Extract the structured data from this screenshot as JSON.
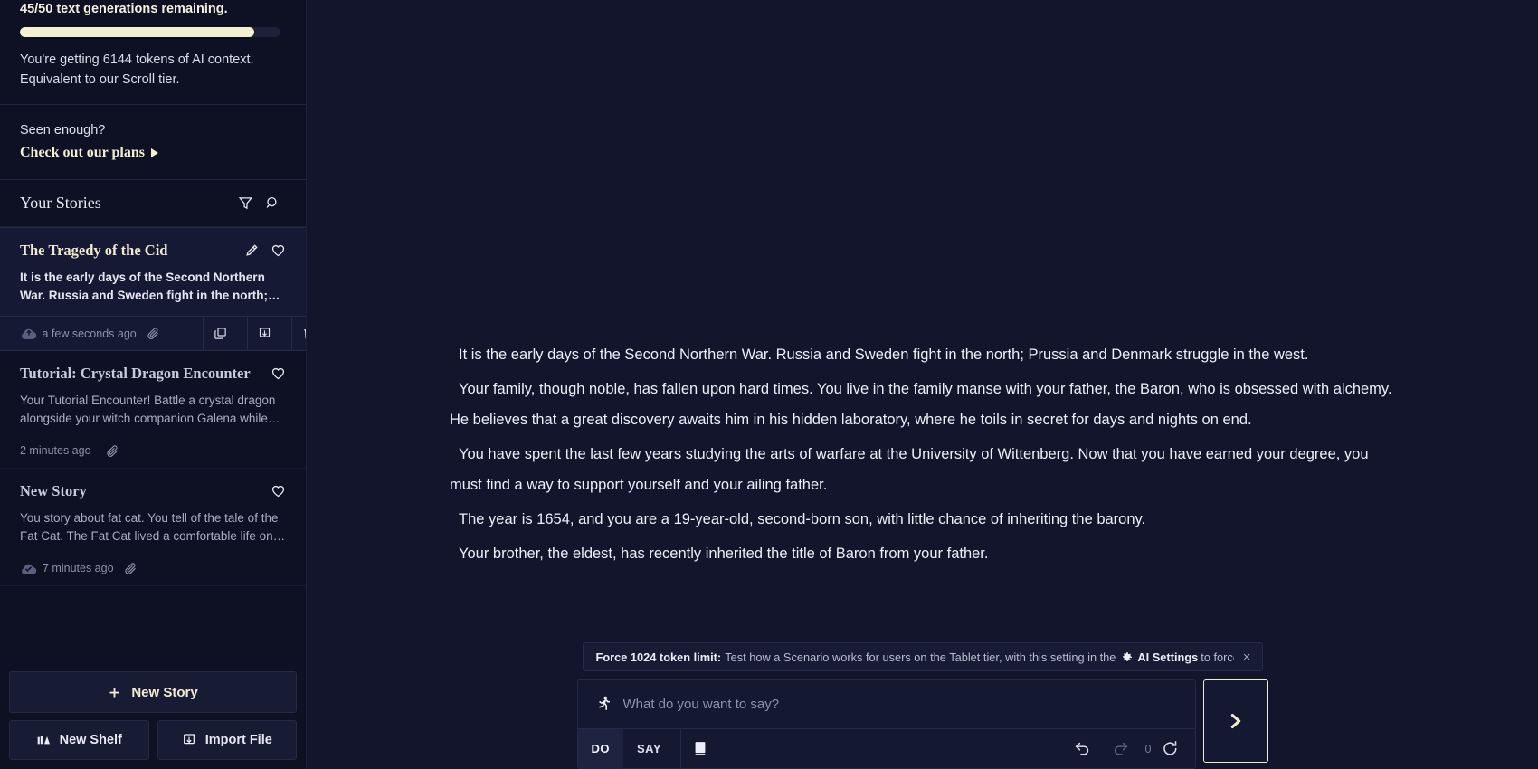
{
  "sidebar": {
    "usage": {
      "headline": "45/50 text generations remaining.",
      "progress_percent": 90,
      "context_line1": "You're getting 6144 tokens of AI context.",
      "context_line2": "Equivalent to our Scroll tier."
    },
    "plans": {
      "question": "Seen enough?",
      "link_label": "Check out our plans"
    },
    "stories_header": {
      "title": "Your Stories",
      "filter_icon": "filter-icon",
      "search_icon": "search-icon"
    },
    "stories": [
      {
        "title": "The Tragedy of the Cid",
        "description": "It is the early days of the Second Northern War. Russia and Sweden fight in the north; Prussia and…",
        "timestamp": "a few seconds ago",
        "sync_icon": "cloud-upload-icon",
        "attach_icon": "paperclip-icon",
        "edit_icon": "pencil-icon",
        "favorite_icon": "heart-icon",
        "active": true,
        "actions": [
          "duplicate-icon",
          "download-icon",
          "trash-icon"
        ]
      },
      {
        "title": "Tutorial: Crystal Dragon Encounter",
        "description": "Your Tutorial Encounter! Battle a crystal dragon alongside your witch companion Galena while you lear…",
        "timestamp": "2 minutes ago",
        "attach_icon": "paperclip-icon",
        "favorite_icon": "heart-icon",
        "active": false
      },
      {
        "title": "New Story",
        "description": "You story about fat cat. You tell of the tale of the Fat Cat. The Fat Cat lived a comfortable life on the farm, eating…",
        "timestamp": "7 minutes ago",
        "sync_icon": "cloud-check-icon",
        "attach_icon": "paperclip-icon",
        "favorite_icon": "heart-icon",
        "active": false
      }
    ],
    "footer": {
      "new_story": "New Story",
      "new_shelf": "New Shelf",
      "import_file": "Import File"
    }
  },
  "main": {
    "story_paragraphs": [
      "It is the early days of the Second Northern War. Russia and Sweden fight in the north; Prussia and Denmark struggle in the west.",
      "Your family, though noble, has fallen upon hard times. You live in the family manse with your father, the Baron, who is obsessed with alchemy. He believes that a great discovery awaits him in his hidden laboratory, where he toils in secret for days and nights on end.",
      "You have spent the last few years studying the arts of warfare at the University of Wittenberg. Now that you have earned your degree, you must find a way to support yourself and your ailing father.",
      "The year is 1654, and you are a 19-year-old, second-born son, with little chance of inheriting the barony.",
      "Your brother, the eldest, has recently inherited the title of Baron from your father."
    ],
    "toast": {
      "label": "Force 1024 token limit:",
      "body_before": "Test how a Scenario works for users on the Tablet tier, with this setting in the",
      "settings_link": "AI Settings",
      "body_after": "to force the…",
      "gear_icon": "gear-icon",
      "close_icon": "close-icon",
      "close_label": "×"
    },
    "composer": {
      "mode_icon": "running-person-icon",
      "placeholder": "What do you want to say?",
      "value": "",
      "mode_do": "DO",
      "mode_say": "SAY",
      "story_icon": "book-icon",
      "undo_icon": "undo-icon",
      "redo_icon": "redo-icon",
      "retry_count": "0",
      "retry_icon": "retry-icon",
      "send_icon": "send-chevron-icon"
    }
  },
  "colors": {
    "accent_cream": "#f2ead0",
    "background": "#12152c",
    "sidebar_bg": "#0e1124",
    "active_card": "#151933"
  }
}
